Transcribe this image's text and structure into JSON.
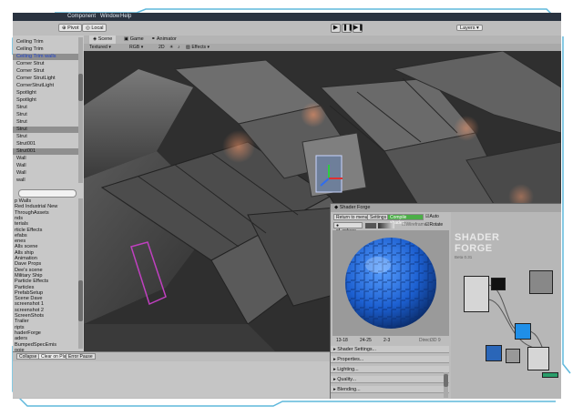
{
  "menu": {
    "component": "Component",
    "window": "Window",
    "help": "Help"
  },
  "toolbar": {
    "pivot": "Pivot",
    "local": "Local",
    "layers": "Layers"
  },
  "scene_view": {
    "tabs": [
      "Scene",
      "Game",
      "Animator"
    ],
    "options": {
      "textured": "Textured",
      "rgb": "RGB",
      "mode2d": "2D",
      "effects": "Effects"
    }
  },
  "hierarchy": {
    "items": [
      "Ceiling Trim",
      "Ceiling Trim",
      "Ceiling Trim walls",
      "Corner Strut",
      "Corner Strut",
      "Corner StrutLight",
      "CornerStrutLight",
      "Spotlight",
      "Spotlight",
      "Strut",
      "Strut",
      "Strut",
      "Strut",
      "Strut",
      "Strut001",
      "Strut001",
      "Wall",
      "Wall",
      "Wall",
      "wall"
    ],
    "selected_indices": [
      2,
      12,
      15
    ]
  },
  "project": {
    "items": [
      "p Walls",
      "Red Industrial New",
      "ThroughAssets",
      "nds",
      "terials",
      "rticle Effects",
      "efabs",
      "enes",
      "Alls scene",
      "Alls ship",
      "Animation",
      "Dave Props",
      "Dee's scene",
      "Military Ship",
      "Particle Effects",
      "Particles",
      "PrefabSetup",
      "Scene Dave",
      "screenshot 1",
      "screenshot 2",
      "ScreenShots",
      "Trailer",
      "ripts",
      "haderForge",
      "aders",
      "BumpedSpecEmis",
      "ooie"
    ]
  },
  "console": {
    "collapse": "Collapse",
    "clear_on_play": "Clear on Play",
    "error_pause": "Error Pause"
  },
  "shader_forge": {
    "title": "Shader Forge",
    "return_to_menu": "Return to menu",
    "settings": "Settings",
    "compile_shader": "Compile shader",
    "auto": "Auto",
    "sphere": "sf_sphere",
    "wireframe": "Wireframe",
    "rotate": "Rotate",
    "logo_line1": "SHADER",
    "logo_line2": "FORGE",
    "version": "Beta 0.31",
    "stats": {
      "vertices": "13-18",
      "fragments": "24-25",
      "third": "2-3",
      "platform": "Direct3D 9"
    },
    "sections": [
      "Shader Settings...",
      "Properties...",
      "Lighting...",
      "Quality...",
      "Blending..."
    ]
  },
  "colors": {
    "accent_frame": "#5fb8dc",
    "compile_green": "#4cae48",
    "sphere_blue": "#1c5fd0",
    "node_blue": "#1f8fe8"
  }
}
